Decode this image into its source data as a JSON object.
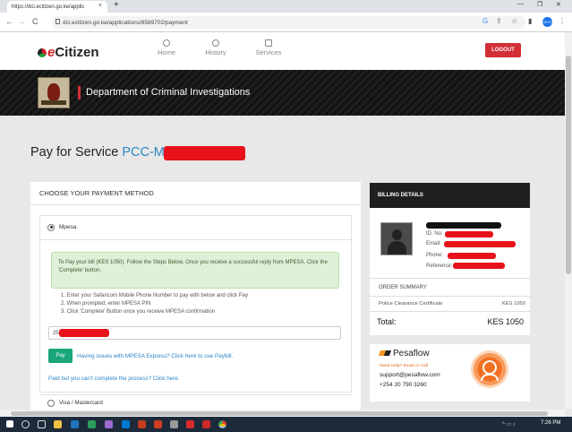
{
  "browser": {
    "tab_title": "https://dci.ecitizen.go.ke/applic",
    "tab_close": "×",
    "new_tab": "+",
    "url": "dci.ecitizen.go.ke/applications/8589702/payment",
    "back": "←",
    "forward": "→",
    "reload": "C",
    "minimize": "—",
    "restore": "❐",
    "close": "✕",
    "profile": "ODYO"
  },
  "header": {
    "logo_prefix": "e",
    "logo_text": "Citizen",
    "nav": [
      {
        "label": "Home"
      },
      {
        "label": "History"
      },
      {
        "label": "Services"
      }
    ],
    "logout_label": "LOGOUT"
  },
  "banner": {
    "title": "Department of Criminal Investigations"
  },
  "page": {
    "title_prefix": "Pay for Service",
    "title_ref": "PCC-M"
  },
  "payment": {
    "heading": "CHOOSE YOUR PAYMENT METHOD",
    "mpesa_label": "Mpesa",
    "instructions": "To Pay your bill (KES 1050). Follow the Steps Below. Once you receive a successful reply from MPESA. Click the 'Complete' button.",
    "steps": [
      "1. Enter your Safaricom Mobile Phone Number to pay with below and click Pay",
      "2. When prompted, enter MPESA PIN",
      "3. Click 'Complete' Button once you receive MPESA confirmation"
    ],
    "phone_value": "254",
    "pay_label": "Pay",
    "paybill_link": "Having issues with MPESA Express? Click here to use Paybill.",
    "paid_link": "Paid but you can't complete the process? Click here.",
    "visa_label": "Visa / Mastercard"
  },
  "billing": {
    "heading": "BILLING DETAILS",
    "id_label": "ID. No:",
    "email_label": "Email:",
    "phone_label": "Phone:",
    "reference_label": "Reference:",
    "summary_heading": "ORDER SUMMARY",
    "item_label": "Police Clearance Certificate",
    "item_amount": "KES 1050",
    "total_label": "Total:",
    "total_amount": "KES 1050"
  },
  "pesaflow": {
    "name": "Pesaflow",
    "help": "Need Help? Email or Call",
    "email": "support@pesaflow.com",
    "phone": "+254 20 790 3260"
  },
  "taskbar": {
    "time": "7:26 PM"
  },
  "colors": {
    "accent_blue": "#2a86c7",
    "logout_red": "#d32f36",
    "pay_green": "#1aa67a",
    "redaction": "#e8121a"
  }
}
